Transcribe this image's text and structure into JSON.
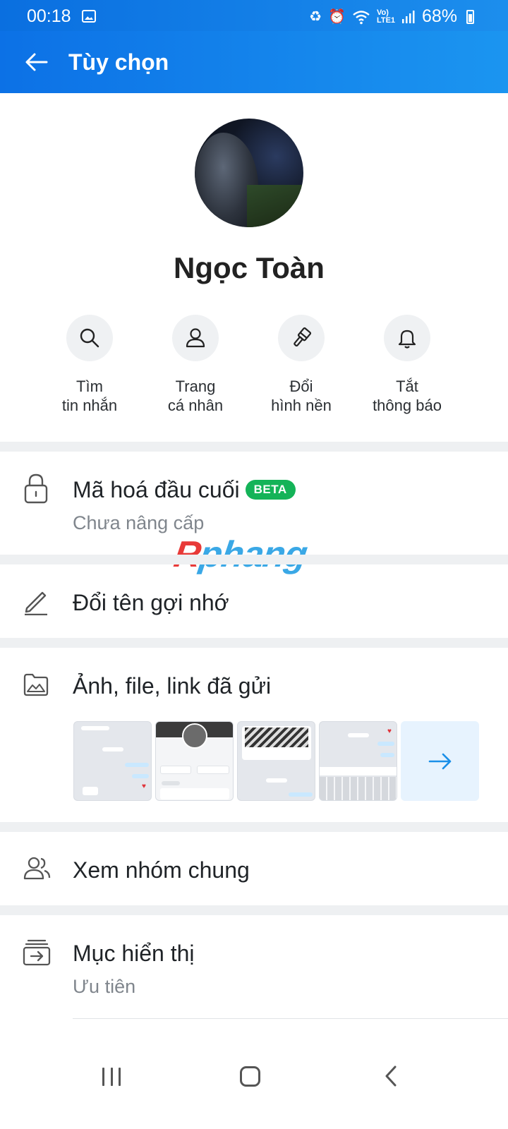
{
  "status_bar": {
    "time": "00:18",
    "network": "Vo) LTE1",
    "battery": "68%"
  },
  "header": {
    "title": "Tùy chọn"
  },
  "profile": {
    "name": "Ngọc Toàn"
  },
  "actions": [
    {
      "line1": "Tìm",
      "line2": "tin nhắn",
      "icon": "search-icon"
    },
    {
      "line1": "Trang",
      "line2": "cá nhân",
      "icon": "person-icon"
    },
    {
      "line1": "Đổi",
      "line2": "hình nền",
      "icon": "paint-brush-icon"
    },
    {
      "line1": "Tắt",
      "line2": "thông báo",
      "icon": "bell-icon"
    }
  ],
  "encryption": {
    "title": "Mã hoá đầu cuối",
    "badge": "BETA",
    "subtitle": "Chưa nâng cấp"
  },
  "watermark": {
    "part1": "R",
    "part2": "phang"
  },
  "rename": {
    "title": "Đổi tên gợi nhớ"
  },
  "media": {
    "title": "Ảnh, file, link đã gửi"
  },
  "groups": {
    "title": "Xem nhóm chung"
  },
  "display": {
    "title": "Mục hiển thị",
    "subtitle": "Ưu tiên"
  },
  "colors": {
    "header": "#1b8bec",
    "beta": "#14b358",
    "accent": "#1a8fe8"
  }
}
